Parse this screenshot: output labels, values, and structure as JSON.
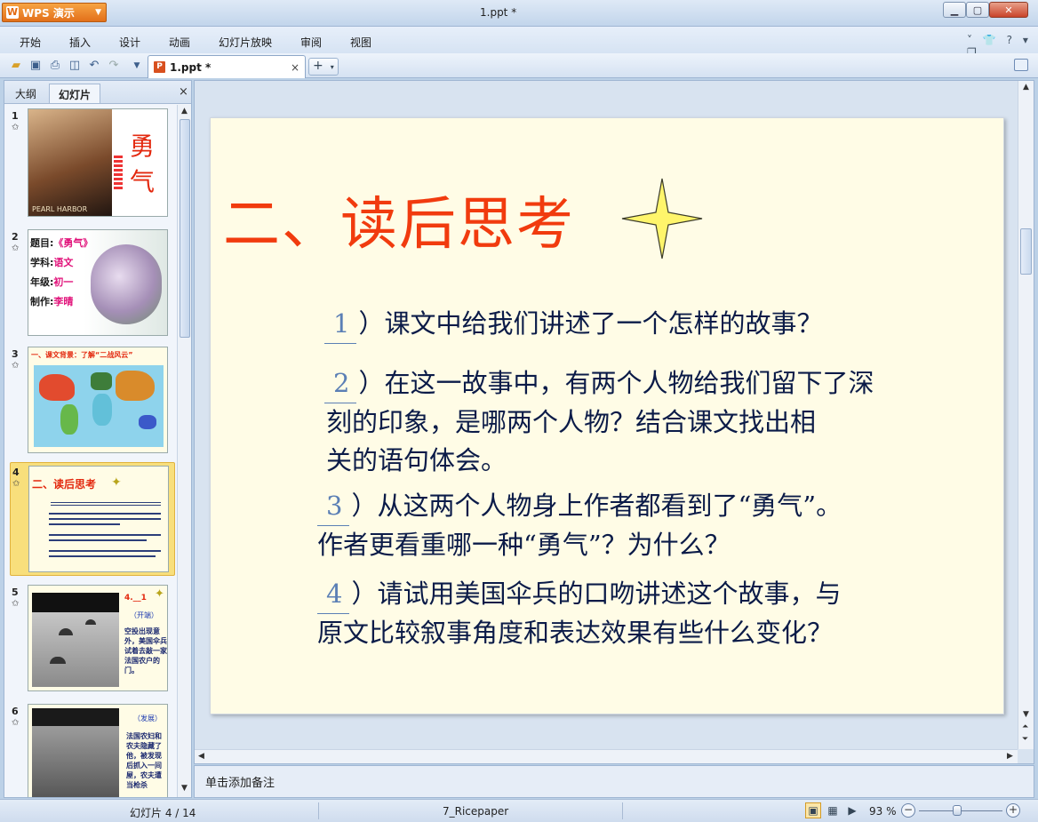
{
  "app": {
    "badge": "WPS 演示",
    "window_title": "1.ppt *"
  },
  "menu": [
    "开始",
    "插入",
    "设计",
    "动画",
    "幻灯片放映",
    "审阅",
    "视图"
  ],
  "doc_tab": {
    "label": "1.ppt *",
    "close": "×",
    "new_tab": "+"
  },
  "panel": {
    "tab_outline": "大纲",
    "tab_slides": "幻灯片",
    "close": "×"
  },
  "thumbnails": [
    {
      "num": "1",
      "star": "✩",
      "title_line1": "勇",
      "title_line2": "气",
      "caption": "PEARL HARBOR"
    },
    {
      "num": "2",
      "star": "✩",
      "rows": [
        [
          "题目:",
          "《勇气》"
        ],
        [
          "学科:",
          "语文"
        ],
        [
          "年级:",
          "初一"
        ],
        [
          "制作:",
          "李晴"
        ]
      ]
    },
    {
      "num": "3",
      "star": "✩",
      "title": "一、课文背景：了解“二战风云”"
    },
    {
      "num": "4",
      "star": "✩",
      "title": "二、读后思考"
    },
    {
      "num": "5",
      "star": "✩",
      "title": "4.__1",
      "sub": "（开端）",
      "body": "空投出现意外，美国伞兵试着去敲一家法国农户的门。"
    },
    {
      "num": "6",
      "star": "✩",
      "sub": "（发展）",
      "body": "法国农妇和农夫隐藏了他，被发现后抓入一间屋，农夫遭当枪杀"
    }
  ],
  "slide": {
    "title": "二、读后思考",
    "questions": [
      {
        "num": "1",
        "lines": [
          "）课文中给我们讲述了一个怎样的故事？"
        ]
      },
      {
        "num": "2",
        "lines": [
          "）在这一故事中，有两个人物给我们留下了深",
          "刻的印象，是哪两个人物？结合课文找出相",
          "关的语句体会。"
        ]
      },
      {
        "num": "3",
        "lines": [
          "）从这两个人物身上作者都看到了“勇气”。",
          "作者更看重哪一种“勇气”？为什么？"
        ]
      },
      {
        "num": "4",
        "lines": [
          "）请试用美国伞兵的口吻讲述这个故事，与",
          "原文比较叙事角度和表达效果有些什么变化？"
        ]
      }
    ]
  },
  "notes_placeholder": "单击添加备注",
  "status": {
    "slide_count": "幻灯片 4 / 14",
    "theme": "7_Ricepaper",
    "zoom": "93 %",
    "zoom_level_percent": 93
  },
  "colors": {
    "title_red": "#f13b0e",
    "question_navy": "#0b1b48",
    "slide_bg": "#fffce6",
    "selected_thumb": "#f8df7c"
  }
}
